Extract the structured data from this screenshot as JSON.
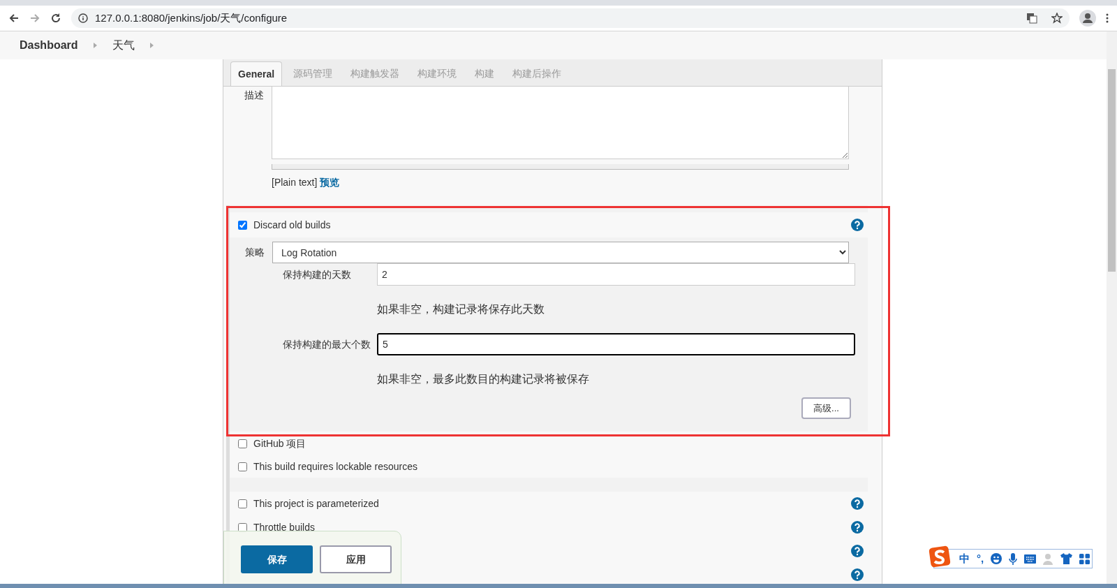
{
  "browser": {
    "url": "127.0.0.1:8080/jenkins/job/天气/configure"
  },
  "breadcrumbs": [
    "Dashboard",
    "天气"
  ],
  "tabs": [
    {
      "label": "General",
      "selected": true
    },
    {
      "label": "源码管理",
      "selected": false
    },
    {
      "label": "构建触发器",
      "selected": false
    },
    {
      "label": "构建环境",
      "selected": false
    },
    {
      "label": "构建",
      "selected": false
    },
    {
      "label": "构建后操作",
      "selected": false
    }
  ],
  "description": {
    "label": "描述",
    "format": "[Plain text]",
    "preview_link": "预览"
  },
  "discard_old_builds": {
    "label": "Discard old builds",
    "checked": true,
    "strategy_label": "策略",
    "strategy": "Log Rotation",
    "fields": [
      {
        "label": "保持构建的天数",
        "value": "2",
        "hint": "如果非空，构建记录将保存此天数",
        "focused": false
      },
      {
        "label": "保持构建的最大个数",
        "value": "5",
        "hint": "如果非空，最多此数目的构建记录将被保存",
        "focused": true
      }
    ],
    "advanced_button": "高级..."
  },
  "options": [
    {
      "label": "GitHub 项目",
      "checked": false,
      "help": false
    },
    {
      "label": "This build requires lockable resources",
      "checked": false,
      "help": false
    },
    {
      "label": "This project is parameterized",
      "checked": false,
      "help": true
    },
    {
      "label": "Throttle builds",
      "checked": false,
      "help": true
    }
  ],
  "buttons": [
    "保存",
    "应用"
  ],
  "ime_toolbar": {
    "mode": "中",
    "punctuation": "°,"
  }
}
